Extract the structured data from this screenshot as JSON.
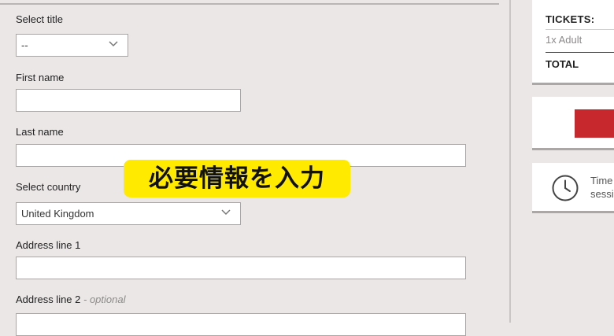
{
  "form": {
    "title_label": "Select title",
    "title_value": "--",
    "first_name_label": "First name",
    "first_name_value": "",
    "last_name_label": "Last name",
    "last_name_value": "",
    "country_label": "Select country",
    "country_value": "United Kingdom",
    "address1_label": "Address line 1",
    "address1_value": "",
    "address2_label": "Address line 2",
    "address2_optional": "- optional",
    "address2_value": ""
  },
  "summary": {
    "tickets_title": "TICKETS:",
    "ticket_line": "1x Adult",
    "total_label": "TOTAL"
  },
  "timer": {
    "line1": "Time",
    "line2": "sessi"
  },
  "overlay": {
    "caption": "必要情報を入力"
  },
  "icons": {
    "select_arrow": "chevron-down-icon",
    "timer": "clock-icon"
  },
  "colors": {
    "accent_red": "#c7282d",
    "caption_yellow": "#ffea00",
    "page_background": "#ebe7e7"
  }
}
